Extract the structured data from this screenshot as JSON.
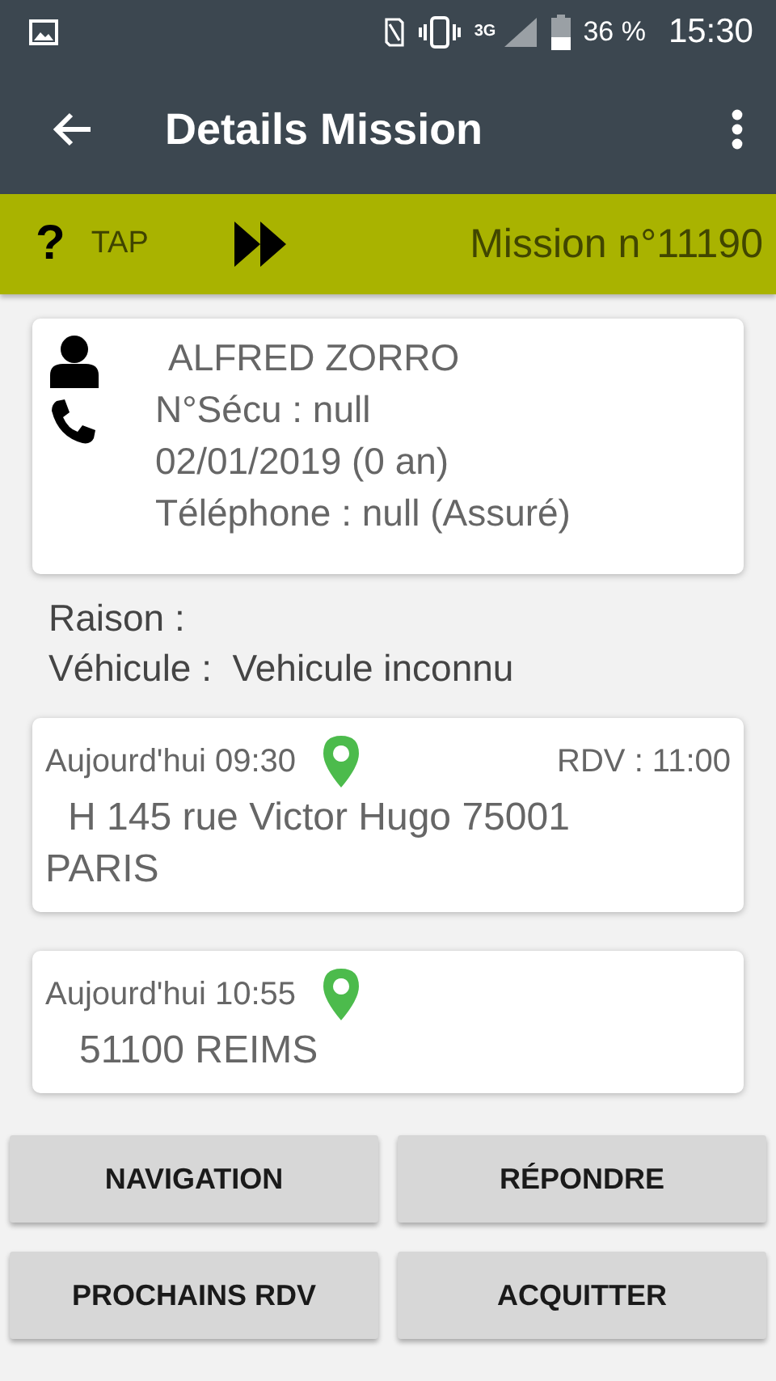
{
  "status_bar": {
    "network": "3G",
    "battery": "36 %",
    "time": "15:30"
  },
  "app_bar": {
    "title": "Details Mission"
  },
  "mission_bar": {
    "help": "?",
    "tap": "TAP",
    "mission": "Mission n°11190"
  },
  "patient": {
    "name": "ALFRED ZORRO",
    "lines": [
      "N°Sécu : null",
      "02/01/2019 (0 an)",
      "Téléphone : null (Assuré)"
    ]
  },
  "info": [
    "Raison :",
    "Véhicule :  Vehicule inconnu"
  ],
  "stops": [
    {
      "time": "Aujourd'hui 09:30",
      "rdv": "RDV : 11:00",
      "address": "H 145 rue Victor Hugo 75001 PARIS"
    },
    {
      "time": "Aujourd'hui 10:55",
      "address": "51100 REIMS"
    }
  ],
  "buttons": [
    "NAVIGATION",
    "RÉPONDRE",
    "PROCHAINS RDV",
    "ACQUITTER"
  ]
}
